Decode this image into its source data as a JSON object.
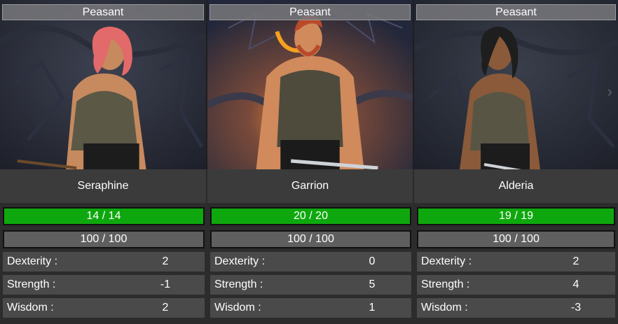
{
  "characters": [
    {
      "class": "Peasant",
      "name": "Seraphine",
      "hp": "14 / 14",
      "hp_fraction": 1.0,
      "mp": "100 / 100",
      "stats": [
        {
          "label": "Dexterity :",
          "value": "2"
        },
        {
          "label": "Strength :",
          "value": "-1"
        },
        {
          "label": "Wisdom :",
          "value": "2"
        }
      ],
      "hair_color": "#e36a6a",
      "skin_color": "#c68a5e"
    },
    {
      "class": "Peasant",
      "name": "Garrion",
      "hp": "20 / 20",
      "hp_fraction": 1.0,
      "mp": "100 / 100",
      "stats": [
        {
          "label": "Dexterity :",
          "value": "0"
        },
        {
          "label": "Strength :",
          "value": "5"
        },
        {
          "label": "Wisdom :",
          "value": "1"
        }
      ],
      "hair_color": "#b84a2a",
      "skin_color": "#d08a5c"
    },
    {
      "class": "Peasant",
      "name": "Alderia",
      "hp": "19 / 19",
      "hp_fraction": 1.0,
      "mp": "100 / 100",
      "stats": [
        {
          "label": "Dexterity :",
          "value": "2"
        },
        {
          "label": "Strength :",
          "value": "4"
        },
        {
          "label": "Wisdom :",
          "value": "-3"
        }
      ],
      "hair_color": "#1e1e1e",
      "skin_color": "#8a5a3a"
    }
  ],
  "colors": {
    "hp_bar": "#0ea80e",
    "mp_bar": "#5f5f5f",
    "stat_bg": "#4a4a4a",
    "name_bg": "#3b3b3b"
  },
  "icons": {
    "prev": "chevron-left-icon",
    "next": "chevron-right-icon"
  }
}
